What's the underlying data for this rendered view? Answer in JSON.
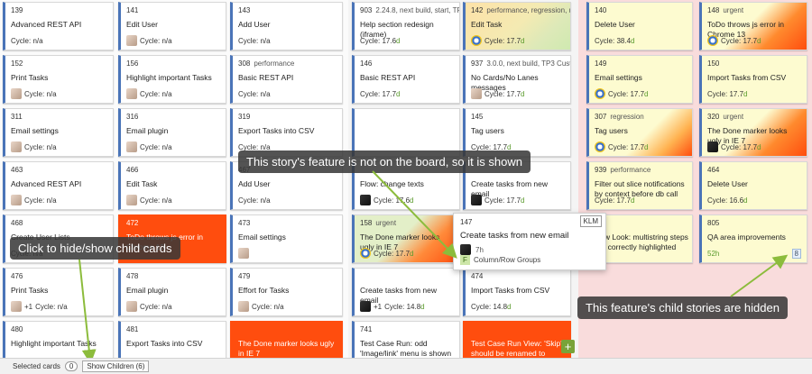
{
  "colors": {
    "lane_right_bg": "#f9dcdc",
    "blue_border": "#4a74b8",
    "yellow_card": "#fdfbd0",
    "red_card": "#ff4d0e",
    "green_accent": "#8cbc3c"
  },
  "columns": [
    {
      "cards": [
        {
          "id": "139",
          "tags": "",
          "title": "Advanced REST API",
          "cycle_label": "Cycle:",
          "cycle_value": "n/a"
        },
        {
          "id": "152",
          "tags": "",
          "title": "Print Tasks",
          "cycle_label": "Cycle:",
          "cycle_value": "n/a",
          "avatar": "face"
        },
        {
          "id": "311",
          "tags": "",
          "title": "Email settings",
          "cycle_label": "Cycle:",
          "cycle_value": "n/a",
          "avatar": "face"
        },
        {
          "id": "463",
          "tags": "",
          "title": "Advanced REST API",
          "cycle_label": "Cycle:",
          "cycle_value": "n/a",
          "avatar": "face"
        },
        {
          "id": "468",
          "tags": "",
          "title": "Create User Lists",
          "cycle_label": "Cycle:",
          "cycle_value": "n/a"
        },
        {
          "id": "476",
          "tags": "",
          "title": "Print Tasks",
          "cycle_label": "Cycle:",
          "cycle_value": "n/a",
          "avatar": "face",
          "plus": "+1"
        },
        {
          "id": "480",
          "tags": "",
          "title": "Highlight important Tasks",
          "cycle_label": "",
          "cycle_value": ""
        }
      ]
    },
    {
      "cards": [
        {
          "id": "141",
          "tags": "",
          "title": "Edit User",
          "cycle_label": "Cycle:",
          "cycle_value": "n/a",
          "avatar": "face"
        },
        {
          "id": "156",
          "tags": "",
          "title": "Highlight important Tasks",
          "cycle_label": "Cycle:",
          "cycle_value": "n/a",
          "avatar": "face"
        },
        {
          "id": "316",
          "tags": "",
          "title": "Email plugin",
          "cycle_label": "Cycle:",
          "cycle_value": "n/a",
          "avatar": "face"
        },
        {
          "id": "466",
          "tags": "",
          "title": "Edit Task",
          "cycle_label": "Cycle:",
          "cycle_value": "n/a",
          "avatar": "face"
        },
        {
          "id": "472",
          "tags": "",
          "title": "ToDo throws js error in Chrome 13",
          "cycle_label": "",
          "cycle_value": "",
          "style": "red"
        },
        {
          "id": "478",
          "tags": "",
          "title": "Email plugin",
          "cycle_label": "Cycle:",
          "cycle_value": "n/a",
          "avatar": "face"
        },
        {
          "id": "481",
          "tags": "",
          "title": "Export Tasks into CSV",
          "cycle_label": "",
          "cycle_value": ""
        }
      ]
    },
    {
      "cards": [
        {
          "id": "143",
          "tags": "",
          "title": "Add User",
          "cycle_label": "Cycle:",
          "cycle_value": "n/a"
        },
        {
          "id": "308",
          "tags": "performance",
          "title": "Basic REST API",
          "cycle_label": "Cycle:",
          "cycle_value": "n/a"
        },
        {
          "id": "319",
          "tags": "",
          "title": "Export Tasks into CSV",
          "cycle_label": "Cycle:",
          "cycle_value": "n/a"
        },
        {
          "id": "467",
          "tags": "",
          "title": "Add User",
          "cycle_label": "Cycle:",
          "cycle_value": "n/a"
        },
        {
          "id": "473",
          "tags": "",
          "title": "Email settings",
          "cycle_label": "",
          "cycle_value": "",
          "avatar": "face"
        },
        {
          "id": "479",
          "tags": "",
          "title": "Effort for Tasks",
          "cycle_label": "Cycle:",
          "cycle_value": "n/a",
          "avatar": "face"
        },
        {
          "id": "",
          "tags": "",
          "title": "The Done marker looks ugly in IE 7",
          "cycle_label": "",
          "cycle_value": "",
          "style": "red"
        }
      ]
    },
    {
      "cards": [
        {
          "id": "903",
          "tags": "2.24.8, next build, start, TP3 Cu",
          "title": "Help section redesign (iframe)",
          "cycle_label": "Cycle:",
          "cycle_value": "17.6",
          "cycle_unit": "d"
        },
        {
          "id": "146",
          "tags": "",
          "title": "Basic REST API",
          "cycle_label": "Cycle:",
          "cycle_value": "17.7",
          "cycle_unit": "d"
        },
        {
          "id": "",
          "tags": "",
          "title": "",
          "cycle_label": "",
          "cycle_value": ""
        },
        {
          "id": "",
          "tags": "",
          "title": "Flow: change texts",
          "cycle_label": "Cycle:",
          "cycle_value": "17.6",
          "cycle_unit": "d",
          "avatar": "dark"
        },
        {
          "id": "158",
          "tags": "urgent",
          "title": "The Done marker looks ugly in IE 7",
          "cycle_label": "Cycle:",
          "cycle_value": "17.7",
          "cycle_unit": "d",
          "style": "green-red",
          "avatar": "ring"
        },
        {
          "id": "",
          "tags": "",
          "title": "Create tasks from new email",
          "cycle_label": "Cycle:",
          "cycle_value": "14.8",
          "cycle_unit": "d",
          "avatar": "dark",
          "plus": "+1"
        },
        {
          "id": "741",
          "tags": "",
          "title": "Test Case Run: odd 'Image/link' menu is shown on attach full size",
          "cycle_label": "",
          "cycle_value": ""
        }
      ]
    },
    {
      "cards": [
        {
          "id": "142",
          "tags": "performance, regression, urge",
          "title": "Edit Task",
          "cycle_label": "Cycle:",
          "cycle_value": "17.7",
          "cycle_unit": "d",
          "style": "grad-green",
          "avatar": "ring"
        },
        {
          "id": "937",
          "tags": "3.0.0, next build, TP3 Custome",
          "title": "No Cards/No Lanes messages",
          "cycle_label": "Cycle:",
          "cycle_value": "17.7",
          "cycle_unit": "d",
          "avatar": "face"
        },
        {
          "id": "145",
          "tags": "",
          "title": "Tag users",
          "cycle_label": "Cycle:",
          "cycle_value": "17.7",
          "cycle_unit": "d"
        },
        {
          "id": "",
          "tags": "",
          "title": "Create tasks from new email",
          "cycle_label": "Cycle:",
          "cycle_value": "17.7",
          "cycle_unit": "d",
          "avatar": "dark"
        },
        {
          "id": "",
          "tags": "",
          "title": "",
          "cycle_label": "",
          "cycle_value": ""
        },
        {
          "id": "474",
          "tags": "",
          "title": "Import Tasks from CSV",
          "cycle_label": "Cycle:",
          "cycle_value": "14.8",
          "cycle_unit": "d"
        },
        {
          "id": "",
          "tags": "",
          "title": "Test Case Run View: 'Skip' should be renamed to 'Skipped'",
          "cycle_label": "",
          "cycle_value": "",
          "style": "red"
        }
      ]
    },
    {
      "cards": [
        {
          "id": "140",
          "tags": "",
          "title": "Delete User",
          "cycle_label": "Cycle:",
          "cycle_value": "38.4",
          "cycle_unit": "d",
          "style": "yellow"
        },
        {
          "id": "149",
          "tags": "",
          "title": "Email settings",
          "cycle_label": "Cycle:",
          "cycle_value": "17.7",
          "cycle_unit": "d",
          "style": "yellow",
          "avatar": "ring"
        },
        {
          "id": "307",
          "tags": "regression",
          "title": "Tag users",
          "cycle_label": "Cycle:",
          "cycle_value": "17.7",
          "cycle_unit": "d",
          "style": "grad-orange",
          "avatar": "ring"
        },
        {
          "id": "939",
          "tags": "performance",
          "title": "Filter out slice notifications by context before db call",
          "cycle_label": "Cycle:",
          "cycle_value": "17.7",
          "cycle_unit": "d",
          "style": "yellow"
        },
        {
          "id": "",
          "tags": "",
          "title": "New Look: multistring steps are correctly highlighted while",
          "cycle_label": "",
          "cycle_value": "",
          "style": "yellow"
        }
      ]
    },
    {
      "cards": [
        {
          "id": "148",
          "tags": "urgent",
          "title": "ToDo throws js error in Chrome 13",
          "cycle_label": "Cycle:",
          "cycle_value": "17.7",
          "cycle_unit": "d",
          "style": "grad-red",
          "avatar": "ring"
        },
        {
          "id": "150",
          "tags": "",
          "title": "Import Tasks from CSV",
          "cycle_label": "Cycle:",
          "cycle_value": "17.7",
          "cycle_unit": "d",
          "style": "yellow"
        },
        {
          "id": "320",
          "tags": "urgent",
          "title": "The Done marker looks ugly in IE 7",
          "cycle_label": "Cycle:",
          "cycle_value": "17.7",
          "cycle_unit": "d",
          "style": "grad-red",
          "avatar": "dark"
        },
        {
          "id": "464",
          "tags": "",
          "title": "Delete User",
          "cycle_label": "Cycle:",
          "cycle_value": "16.6",
          "cycle_unit": "d",
          "style": "yellow"
        },
        {
          "id": "805",
          "tags": "",
          "title": "QA area improvements",
          "cycle_label": "",
          "cycle_value": "",
          "effort": "52h",
          "style": "yellow",
          "count": "8"
        }
      ]
    }
  ],
  "popup": {
    "id": "147",
    "badge": "KLM",
    "title": "Create tasks from new email",
    "effort": "7h",
    "feature_badge": "F",
    "feature_label": "Column/Row Groups"
  },
  "tooltips": {
    "feature": "This story's feature is not on the board, so it is shown",
    "hide_show": "Click to hide/show child cards",
    "hidden": "This feature's child stories are hidden"
  },
  "bottombar": {
    "selected_label": "Selected cards",
    "selected_count": "0",
    "show_children": "Show Children (6)"
  }
}
